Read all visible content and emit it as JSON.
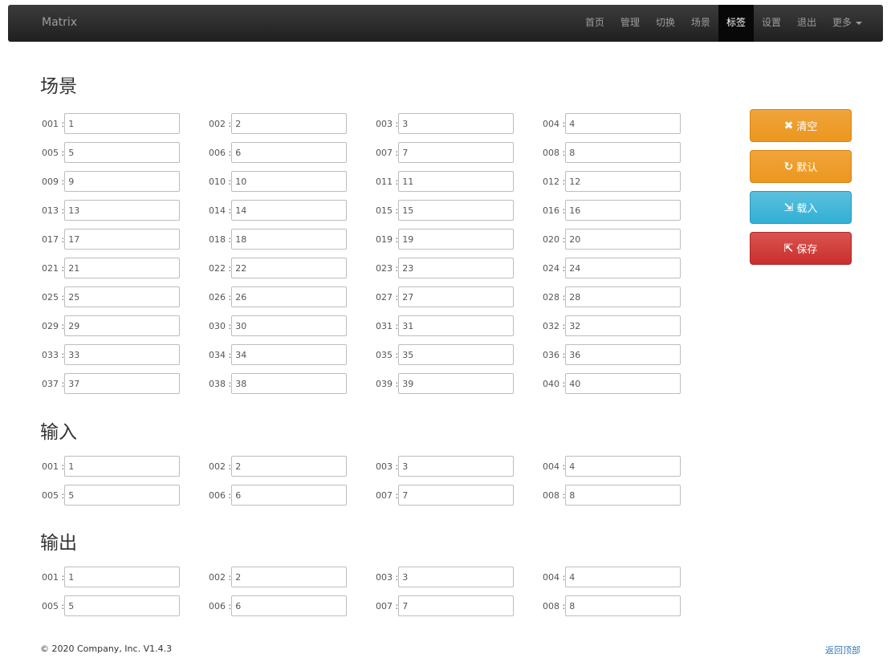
{
  "brand": "Matrix",
  "nav": [
    "首页",
    "管理",
    "切换",
    "场景",
    "标签",
    "设置",
    "退出",
    "更多"
  ],
  "nav_active_index": 4,
  "sections": [
    {
      "title": "场景",
      "items": [
        {
          "label": "001 :",
          "value": "1"
        },
        {
          "label": "002 :",
          "value": "2"
        },
        {
          "label": "003 :",
          "value": "3"
        },
        {
          "label": "004 :",
          "value": "4"
        },
        {
          "label": "005 :",
          "value": "5"
        },
        {
          "label": "006 :",
          "value": "6"
        },
        {
          "label": "007 :",
          "value": "7"
        },
        {
          "label": "008 :",
          "value": "8"
        },
        {
          "label": "009 :",
          "value": "9"
        },
        {
          "label": "010 :",
          "value": "10"
        },
        {
          "label": "011 :",
          "value": "11"
        },
        {
          "label": "012 :",
          "value": "12"
        },
        {
          "label": "013 :",
          "value": "13"
        },
        {
          "label": "014 :",
          "value": "14"
        },
        {
          "label": "015 :",
          "value": "15"
        },
        {
          "label": "016 :",
          "value": "16"
        },
        {
          "label": "017 :",
          "value": "17"
        },
        {
          "label": "018 :",
          "value": "18"
        },
        {
          "label": "019 :",
          "value": "19"
        },
        {
          "label": "020 :",
          "value": "20"
        },
        {
          "label": "021 :",
          "value": "21"
        },
        {
          "label": "022 :",
          "value": "22"
        },
        {
          "label": "023 :",
          "value": "23"
        },
        {
          "label": "024 :",
          "value": "24"
        },
        {
          "label": "025 :",
          "value": "25"
        },
        {
          "label": "026 :",
          "value": "26"
        },
        {
          "label": "027 :",
          "value": "27"
        },
        {
          "label": "028 :",
          "value": "28"
        },
        {
          "label": "029 :",
          "value": "29"
        },
        {
          "label": "030 :",
          "value": "30"
        },
        {
          "label": "031 :",
          "value": "31"
        },
        {
          "label": "032 :",
          "value": "32"
        },
        {
          "label": "033 :",
          "value": "33"
        },
        {
          "label": "034 :",
          "value": "34"
        },
        {
          "label": "035 :",
          "value": "35"
        },
        {
          "label": "036 :",
          "value": "36"
        },
        {
          "label": "037 :",
          "value": "37"
        },
        {
          "label": "038 :",
          "value": "38"
        },
        {
          "label": "039 :",
          "value": "39"
        },
        {
          "label": "040 :",
          "value": "40"
        }
      ]
    },
    {
      "title": "输入",
      "items": [
        {
          "label": "001 :",
          "value": "1"
        },
        {
          "label": "002 :",
          "value": "2"
        },
        {
          "label": "003 :",
          "value": "3"
        },
        {
          "label": "004 :",
          "value": "4"
        },
        {
          "label": "005 :",
          "value": "5"
        },
        {
          "label": "006 :",
          "value": "6"
        },
        {
          "label": "007 :",
          "value": "7"
        },
        {
          "label": "008 :",
          "value": "8"
        }
      ]
    },
    {
      "title": "输出",
      "items": [
        {
          "label": "001 :",
          "value": "1"
        },
        {
          "label": "002 :",
          "value": "2"
        },
        {
          "label": "003 :",
          "value": "3"
        },
        {
          "label": "004 :",
          "value": "4"
        },
        {
          "label": "005 :",
          "value": "5"
        },
        {
          "label": "006 :",
          "value": "6"
        },
        {
          "label": "007 :",
          "value": "7"
        },
        {
          "label": "008 :",
          "value": "8"
        }
      ]
    }
  ],
  "buttons": {
    "clear": {
      "label": "清空",
      "icon": "x-icon",
      "color": "#ec971f"
    },
    "default": {
      "label": "默认",
      "icon": "refresh-icon",
      "color": "#ec971f"
    },
    "load": {
      "label": "载入",
      "icon": "import-icon",
      "color": "#5bc0de"
    },
    "save": {
      "label": "保存",
      "icon": "export-icon",
      "color": "#d9534f"
    }
  },
  "footer": {
    "copyright": "© 2020 Company, Inc. V1.4.3",
    "back_to_top": "返回顶部"
  }
}
